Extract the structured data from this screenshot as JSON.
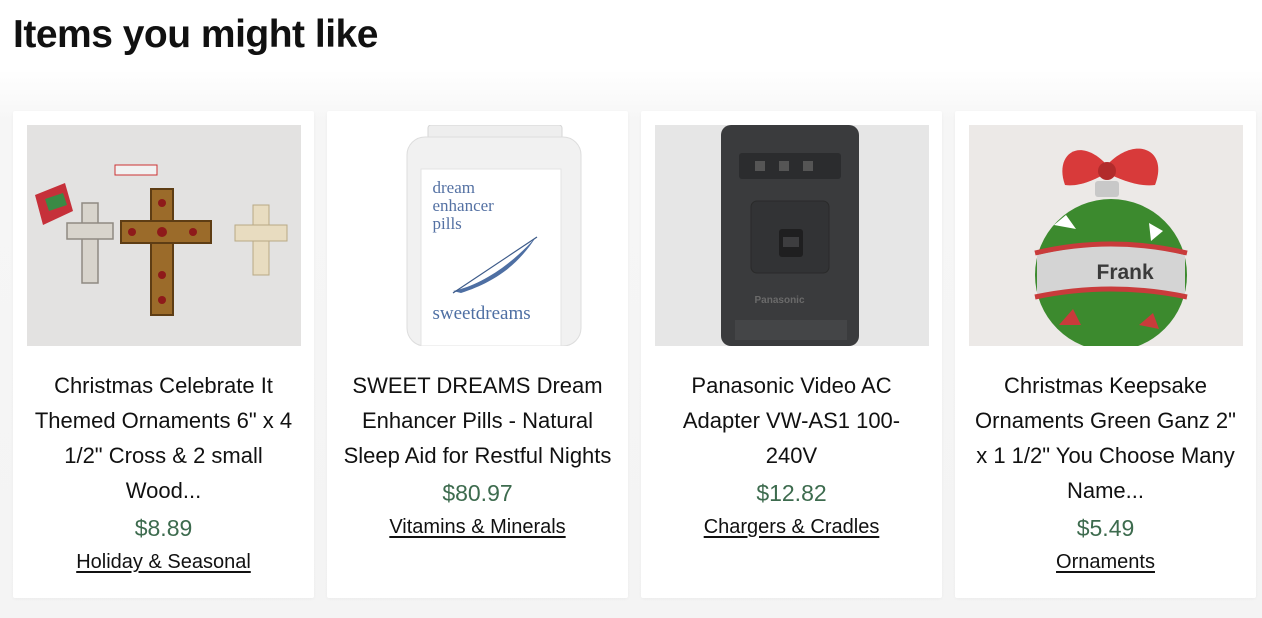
{
  "section": {
    "title": "Items you might like"
  },
  "products": [
    {
      "title": "Christmas Celebrate It Themed Ornaments 6\" x 4 1/2\" Cross & 2 small Wood...",
      "price": "$8.89",
      "category": "Holiday & Seasonal",
      "image_icon": "cross-ornaments-image"
    },
    {
      "title": "SWEET DREAMS Dream Enhancer Pills - Natural Sleep Aid for Restful Nights",
      "price": "$80.97",
      "category": "Vitamins & Minerals",
      "image_icon": "supplement-bottle-image",
      "image_text": {
        "brand_line1": "dream",
        "brand_line2": "enhancer",
        "brand_line3": "pills",
        "brand_name": "sweetdreams"
      }
    },
    {
      "title": "Panasonic Video AC Adapter VW-AS1 100-240V",
      "price": "$12.82",
      "category": "Chargers & Cradles",
      "image_icon": "ac-adapter-image",
      "image_text": {
        "brand_name": "Panasonic"
      }
    },
    {
      "title": "Christmas Keepsake Ornaments Green Ganz 2\" x 1 1/2\" You Choose Many Name...",
      "price": "$5.49",
      "category": "Ornaments",
      "image_icon": "name-ornament-image",
      "image_text": {
        "name": "Frank"
      }
    }
  ],
  "colors": {
    "price": "#3d6b4e",
    "text": "#111111",
    "card": "#ffffff"
  }
}
